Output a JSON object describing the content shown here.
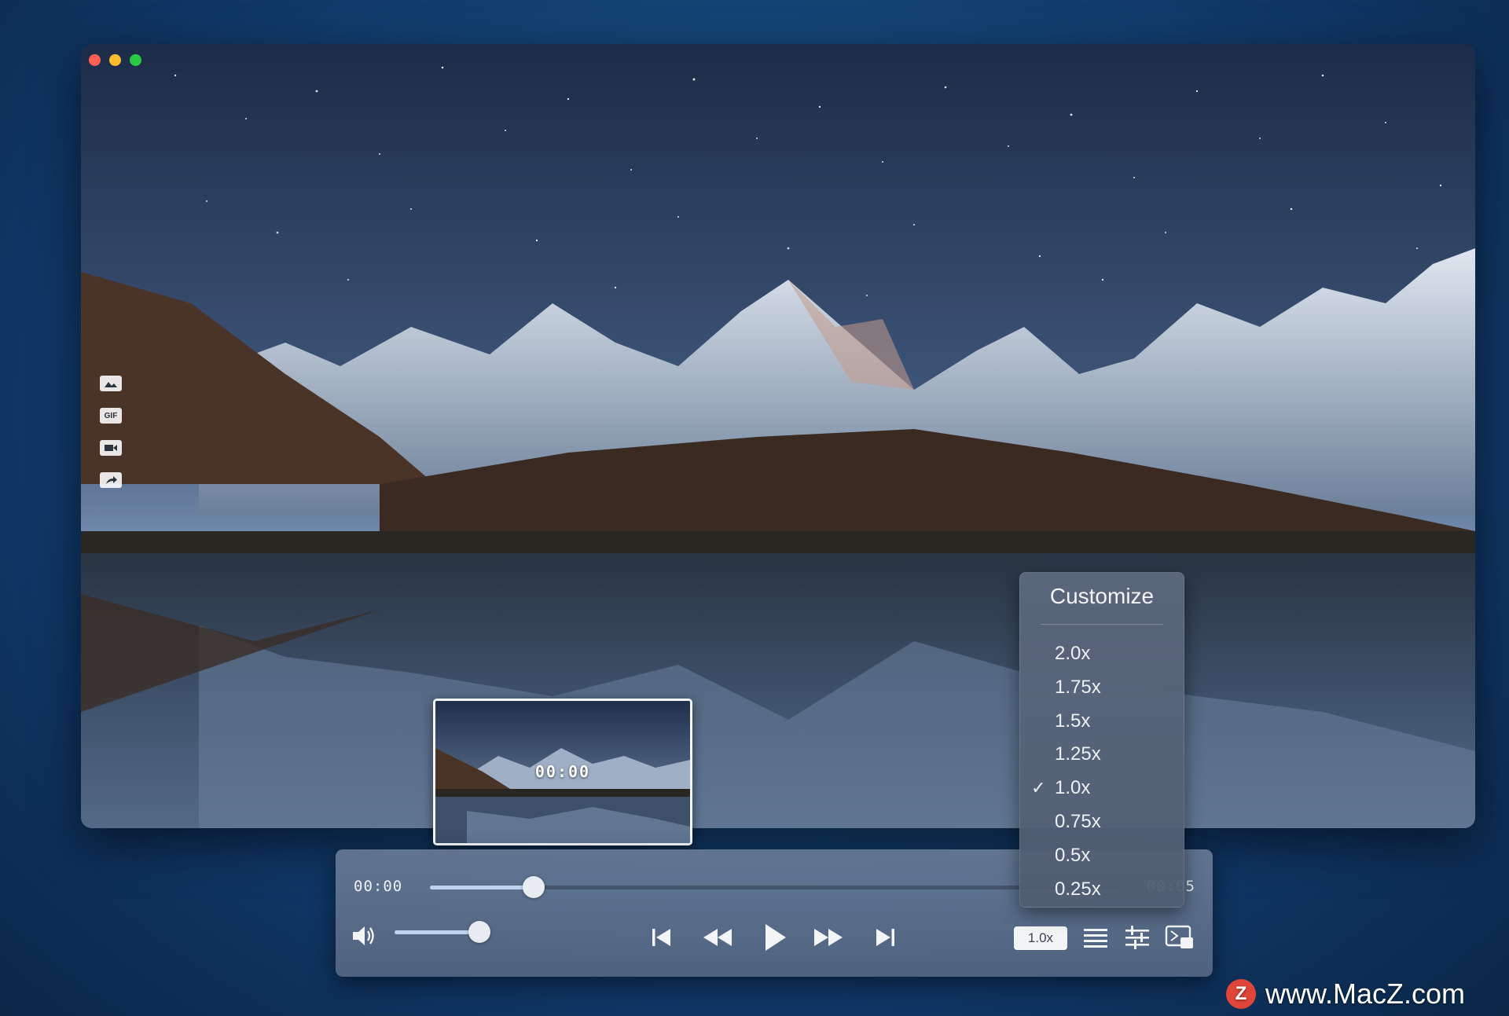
{
  "player": {
    "current_time": "00:00",
    "total_time": "00:05",
    "preview_time": "00:00",
    "progress_fraction": 0.15,
    "volume_fraction": 0.9,
    "speed_label": "1.0x"
  },
  "speed_menu": {
    "header": "Customize",
    "options": [
      "2.0x",
      "1.75x",
      "1.5x",
      "1.25x",
      "1.0x",
      "0.75x",
      "0.5x",
      "0.25x"
    ],
    "selected": "1.0x",
    "check_glyph": "✓"
  },
  "side_tools": [
    {
      "icon": "image-icon",
      "label": ""
    },
    {
      "icon": "gif-icon",
      "label": "GIF"
    },
    {
      "icon": "video-record-icon",
      "label": ""
    },
    {
      "icon": "share-icon",
      "label": ""
    }
  ],
  "watermark": {
    "logo_letter": "Z",
    "text": "www.MacZ.com"
  },
  "colors": {
    "accent": "#bfd4ee",
    "traffic_red": "#ff5f57",
    "traffic_yellow": "#febc2e",
    "traffic_green": "#28c840",
    "watermark_logo": "#e0453a"
  }
}
